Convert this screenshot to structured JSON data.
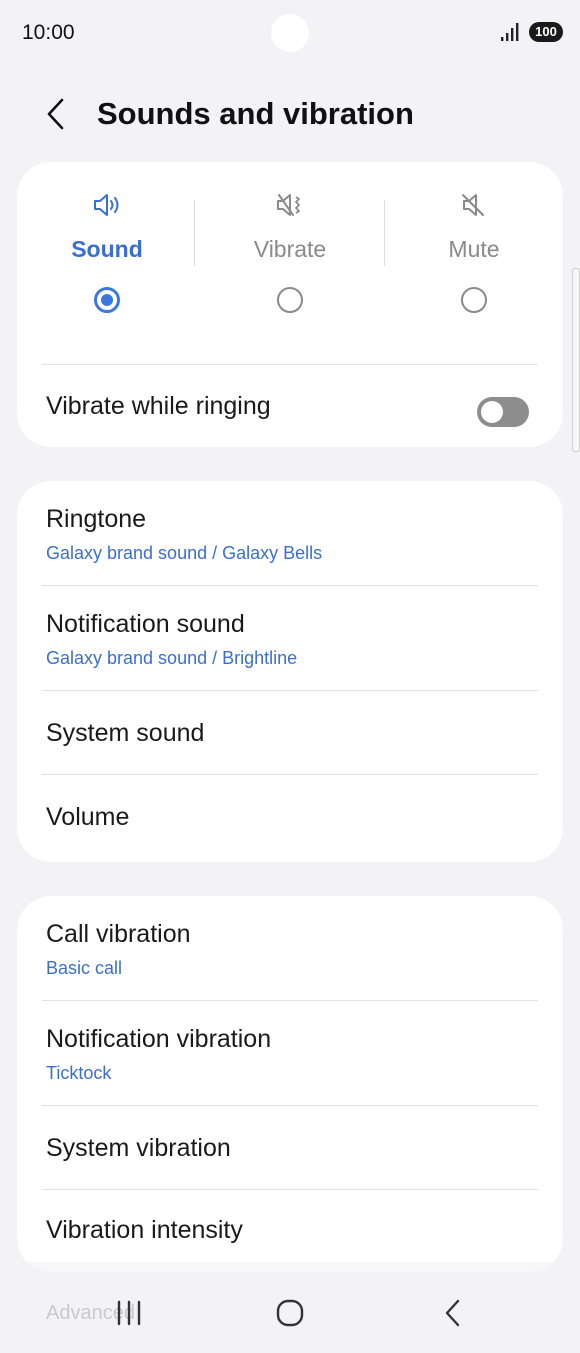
{
  "status_bar": {
    "time": "10:00",
    "battery": "100"
  },
  "header": {
    "title": "Sounds and vibration"
  },
  "sound_mode": {
    "options": [
      {
        "label": "Sound",
        "selected": true
      },
      {
        "label": "Vibrate",
        "selected": false
      },
      {
        "label": "Mute",
        "selected": false
      }
    ],
    "vibrate_while_ringing": {
      "label": "Vibrate while ringing",
      "enabled": false
    }
  },
  "sounds": {
    "items": [
      {
        "title": "Ringtone",
        "subtitle": "Galaxy brand sound / Galaxy Bells"
      },
      {
        "title": "Notification sound",
        "subtitle": "Galaxy brand sound / Brightline"
      },
      {
        "title": "System sound"
      },
      {
        "title": "Volume"
      }
    ]
  },
  "vibration": {
    "items": [
      {
        "title": "Call vibration",
        "subtitle": "Basic call"
      },
      {
        "title": "Notification vibration",
        "subtitle": "Ticktock"
      },
      {
        "title": "System vibration"
      },
      {
        "title": "Vibration intensity"
      }
    ]
  },
  "next_section_peek": "Advanced",
  "colors": {
    "accent": "#3a6fd1",
    "radio_selected": "#3a77e0",
    "background": "#f3f3f5",
    "card": "#ffffff"
  }
}
